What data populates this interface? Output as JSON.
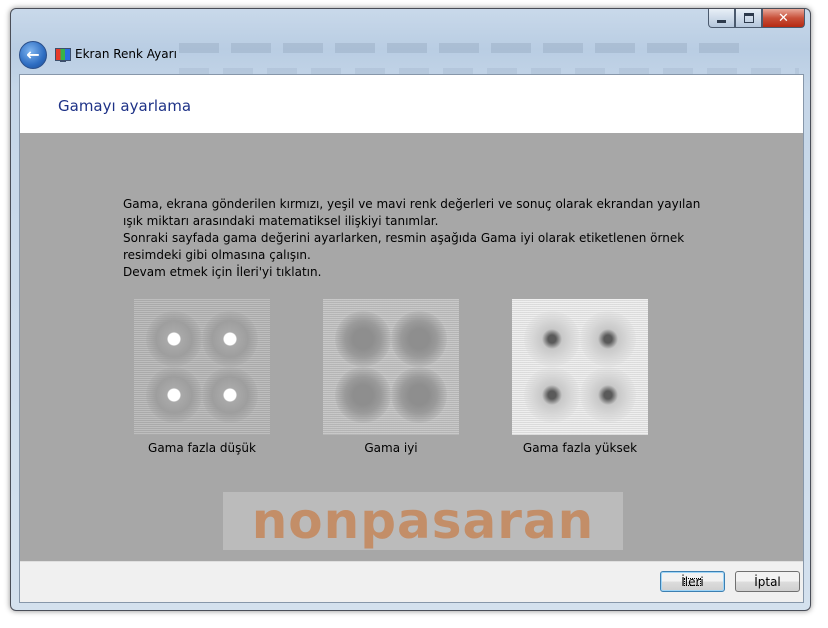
{
  "window": {
    "title": "Ekran Renk Ayarı"
  },
  "page": {
    "heading": "Gamayı ayarlama",
    "description": [
      "Gama, ekrana gönderilen kırmızı, yeşil ve mavi renk değerleri ve sonuç olarak ekrandan yayılan",
      "ışık miktarı arasındaki matematiksel ilişkiyi tanımlar.",
      "Sonraki sayfada gama değerini ayarlarken, resmin aşağıda Gama iyi olarak etiketlenen örnek",
      "resimdeki gibi olmasına çalışın.",
      "Devam etmek için İleri'yi tıklatın."
    ],
    "samples": [
      {
        "caption": "Gama fazla düşük"
      },
      {
        "caption": "Gama iyi"
      },
      {
        "caption": "Gama fazla yüksek"
      }
    ],
    "watermark": "nonpasaran"
  },
  "footer": {
    "next_label": "İleri",
    "cancel_label": "İptal"
  },
  "icons": {
    "back": "back-arrow-icon",
    "app": "display-color-calibration-icon",
    "minimize": "minimize-icon",
    "maximize": "maximize-icon",
    "close": "close-icon"
  }
}
